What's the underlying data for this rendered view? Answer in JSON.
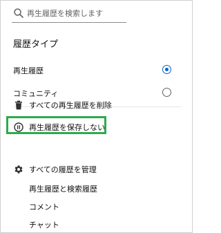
{
  "search": {
    "placeholder": "再生履歴を検索します",
    "icon": "search-icon"
  },
  "history_type": {
    "title": "履歴タイプ",
    "options": [
      {
        "label": "再生履歴",
        "selected": true
      },
      {
        "label": "コミュニティ",
        "selected": false
      }
    ]
  },
  "actions": [
    {
      "label": "すべての再生履歴を削除",
      "icon": "trash-icon"
    },
    {
      "label": "再生履歴を保存しない",
      "icon": "pause-circle-icon"
    },
    {
      "label": "すべての履歴を管理",
      "icon": "gear-icon"
    }
  ],
  "manage_links": [
    {
      "label": "再生履歴と検索履歴"
    },
    {
      "label": "コメント"
    },
    {
      "label": "チャット"
    }
  ],
  "colors": {
    "accent": "#065fd4",
    "highlight_border": "#2bab4b",
    "text": "#0f0f0f",
    "secondary_text": "#606060"
  }
}
